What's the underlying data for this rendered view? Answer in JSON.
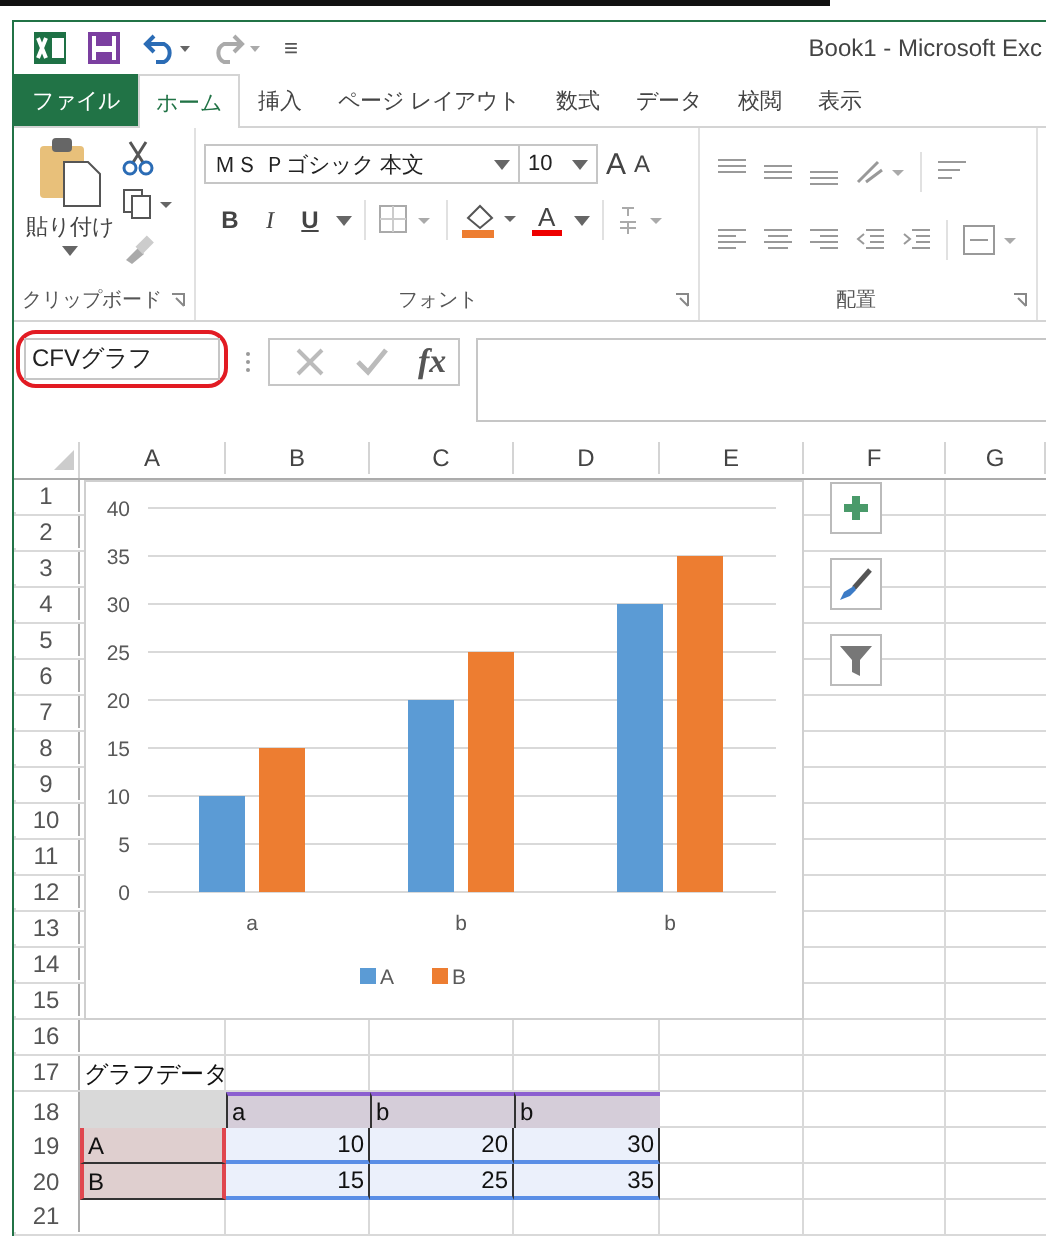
{
  "title_bar": {
    "title": "Book1 - Microsoft Exc",
    "customize": "≡"
  },
  "tabs": [
    {
      "label": "ファイル",
      "kind": "file",
      "selected": false
    },
    {
      "label": "ホーム",
      "kind": "tab",
      "selected": true
    },
    {
      "label": "挿入",
      "kind": "tab",
      "selected": false
    },
    {
      "label": "ページ レイアウト",
      "kind": "tab",
      "selected": false
    },
    {
      "label": "数式",
      "kind": "tab",
      "selected": false
    },
    {
      "label": "データ",
      "kind": "tab",
      "selected": false
    },
    {
      "label": "校閲",
      "kind": "tab",
      "selected": false
    },
    {
      "label": "表示",
      "kind": "tab",
      "selected": false
    }
  ],
  "ribbon": {
    "clipboard": {
      "label": "クリップボード",
      "paste": "貼り付け"
    },
    "font": {
      "label": "フォント",
      "font_name": "ＭＳ Ｐゴシック 本文",
      "font_size": "10",
      "grow": "A",
      "shrink": "A",
      "bold": "B",
      "italic": "I",
      "underline": "U",
      "font_color": "A"
    },
    "alignment": {
      "label": "配置"
    }
  },
  "name_box": {
    "value": "CFVグラフ",
    "highlighted": true
  },
  "formula_bar": {
    "function": "fx"
  },
  "columns": [
    "A",
    "B",
    "C",
    "D",
    "E",
    "F",
    "G"
  ],
  "rows": [
    {
      "number": "1"
    },
    {
      "number": "2"
    },
    {
      "number": "3"
    },
    {
      "number": "4"
    },
    {
      "number": "5"
    },
    {
      "number": "6"
    },
    {
      "number": "7"
    },
    {
      "number": "8"
    },
    {
      "number": "9"
    },
    {
      "number": "10"
    },
    {
      "number": "11"
    },
    {
      "number": "12"
    },
    {
      "number": "13"
    },
    {
      "number": "14"
    },
    {
      "number": "15"
    },
    {
      "number": "16"
    },
    {
      "number": "17",
      "cells": {
        "A": {
          "text": "グラフデータ"
        }
      }
    },
    {
      "number": "18",
      "cells": {
        "A": {
          "kind": "corner"
        },
        "B": {
          "text": "a",
          "kind": "header"
        },
        "C": {
          "text": "b",
          "kind": "header"
        },
        "D": {
          "text": "b",
          "kind": "header"
        }
      }
    },
    {
      "number": "19",
      "cells": {
        "A": {
          "text": "A",
          "kind": "label"
        },
        "B": {
          "text": "10",
          "kind": "values"
        },
        "C": {
          "text": "20",
          "kind": "values"
        },
        "D": {
          "text": "30",
          "kind": "values"
        }
      }
    },
    {
      "number": "20",
      "cells": {
        "A": {
          "text": "B",
          "kind": "label"
        },
        "B": {
          "text": "15",
          "kind": "values"
        },
        "C": {
          "text": "25",
          "kind": "values"
        },
        "D": {
          "text": "35",
          "kind": "values"
        }
      }
    },
    {
      "number": "21"
    }
  ],
  "chart": {
    "chart_data": {
      "type": "bar",
      "categories": [
        "a",
        "b",
        "b"
      ],
      "series": [
        {
          "name": "A",
          "color": "#5b9bd5",
          "values": [
            10,
            20,
            30
          ]
        },
        {
          "name": "B",
          "color": "#ed7d31",
          "values": [
            15,
            25,
            35
          ]
        }
      ],
      "ylim": [
        0,
        40
      ],
      "yticks": [
        {
          "value": 0,
          "label": "0"
        },
        {
          "value": 5,
          "label": "5"
        },
        {
          "value": 10,
          "label": "10"
        },
        {
          "value": 15,
          "label": "15"
        },
        {
          "value": 20,
          "label": "20"
        },
        {
          "value": 25,
          "label": "25"
        },
        {
          "value": 30,
          "label": "30"
        },
        {
          "value": 35,
          "label": "35"
        },
        {
          "value": 40,
          "label": "40"
        }
      ],
      "grid": true,
      "legend": true
    }
  }
}
